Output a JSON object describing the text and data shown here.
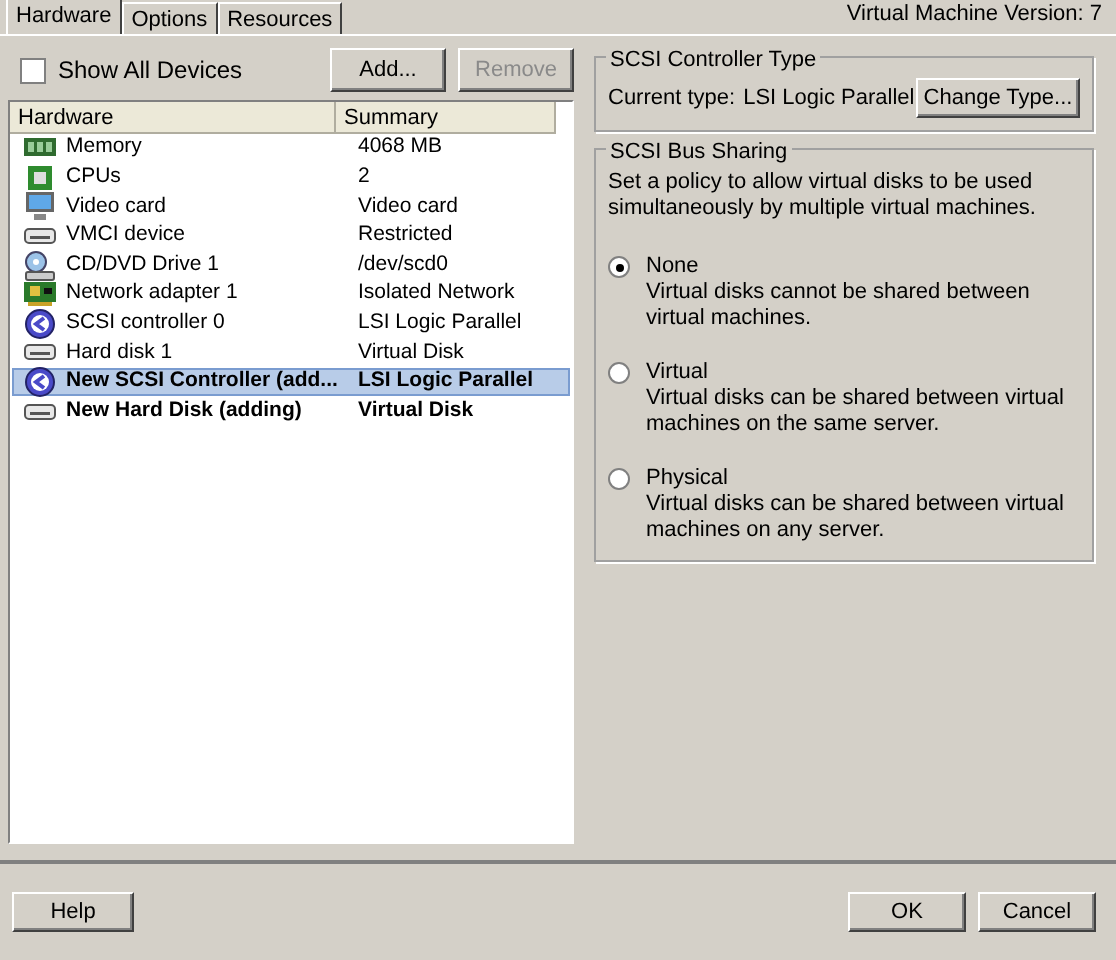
{
  "tabs": [
    {
      "label": "Hardware",
      "selected": true
    },
    {
      "label": "Options",
      "selected": false
    },
    {
      "label": "Resources",
      "selected": false
    }
  ],
  "version": "Virtual Machine Version: 7",
  "show_all": {
    "label": "Show All Devices",
    "checked": false
  },
  "add_button": {
    "label": "Add...",
    "disabled": false
  },
  "remove_button": {
    "label": "Remove",
    "disabled": true
  },
  "table": {
    "columns": [
      "Hardware",
      "Summary"
    ],
    "rows": [
      {
        "kind": "memory",
        "name": "Memory",
        "summary": "4068 MB",
        "adding": false,
        "selected": false
      },
      {
        "kind": "cpu",
        "name": "CPUs",
        "summary": "2",
        "adding": false,
        "selected": false
      },
      {
        "kind": "video",
        "name": "Video card",
        "summary": "Video card",
        "adding": false,
        "selected": false
      },
      {
        "kind": "device",
        "name": "VMCI device",
        "summary": "Restricted",
        "adding": false,
        "selected": false
      },
      {
        "kind": "cdrom",
        "name": "CD/DVD Drive 1",
        "summary": "/dev/scd0",
        "adding": false,
        "selected": false
      },
      {
        "kind": "network",
        "name": "Network adapter 1",
        "summary": "Isolated Network",
        "adding": false,
        "selected": false
      },
      {
        "kind": "scsi",
        "name": "SCSI controller 0",
        "summary": "LSI Logic Parallel",
        "adding": false,
        "selected": false
      },
      {
        "kind": "device",
        "name": "Hard disk 1",
        "summary": "Virtual Disk",
        "adding": false,
        "selected": false
      },
      {
        "kind": "scsi",
        "name": "New SCSI Controller (add...",
        "summary": "LSI Logic Parallel",
        "adding": true,
        "selected": true
      },
      {
        "kind": "device",
        "name": "New Hard Disk (adding)",
        "summary": "Virtual Disk",
        "adding": true,
        "selected": false
      }
    ]
  },
  "controller_type": {
    "title": "SCSI Controller Type",
    "current_label": "Current type:",
    "current_value": "LSI Logic Parallel",
    "button": "Change Type..."
  },
  "bus_sharing": {
    "title": "SCSI Bus Sharing",
    "description": "Set a policy to allow virtual disks to be used simultaneously by multiple virtual machines.",
    "options": [
      {
        "label": "None",
        "description": "Virtual disks cannot be shared between virtual machines.",
        "selected": true
      },
      {
        "label": "Virtual",
        "description": "Virtual disks can be shared between virtual machines on the same server.",
        "selected": false
      },
      {
        "label": "Physical",
        "description": "Virtual disks can be shared between virtual machines on any server.",
        "selected": false
      }
    ]
  },
  "footer": {
    "help": "Help",
    "ok": "OK",
    "cancel": "Cancel"
  }
}
